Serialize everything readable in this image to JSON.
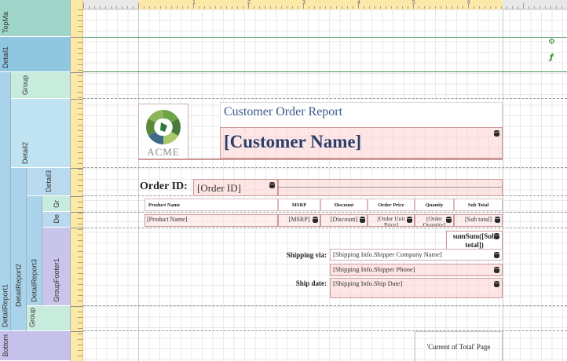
{
  "bands": {
    "top_margin": "TopMa",
    "detail1": "Detail1",
    "group": "Group",
    "detail2": "Detail2",
    "detail3": "Detail3",
    "gr": "Gr",
    "de": "De",
    "detail_report1": "DetailReport1",
    "detail_report2": "DetailReport2",
    "detail_report3": "DetailReport3",
    "group_footer1": "GroupFooter1",
    "group_inner": "Group",
    "bottom": "Bottom"
  },
  "ruler": {
    "numbers": [
      "1",
      "2",
      "3",
      "4",
      "5",
      "6"
    ]
  },
  "report": {
    "title": "Customer Order Report",
    "customer_name": "[Customer Name]",
    "logo_text": "ACME",
    "order_id_label": "Order ID:",
    "order_id_field": "[Order ID]",
    "columns": [
      "Product Name",
      "MSRP",
      "Discount",
      "Order Price",
      "Quanity",
      "Sub Total"
    ],
    "row": [
      "[Product Name]",
      "[MSRP]",
      "[Discount]",
      "[Order Unit Price]",
      "[Order Quantity]",
      "[Sub total]"
    ],
    "sum_field": "sumSum([Sub total])",
    "shipping_via_label": "Shipping via:",
    "shipper_company": "[Shipping Info.Shipper Company Name]",
    "shipper_phone": "[Shipping Info.Shipper Phone]",
    "ship_date_label": "Ship date:",
    "ship_date": "[Shipping Info.Ship Date]",
    "page_info": "'Current of Total' Page"
  },
  "icons": {
    "side_gear": "gear-icon",
    "side_function": "function-icon",
    "db_field": "database-icon"
  },
  "colors": {
    "band_topmargin": "#9fd4c8",
    "band_detail1": "#8fc6e0",
    "band_group": "#c7ecdd",
    "band_detail2": "#bfe3f0",
    "band_detail3": "#b9d9ee",
    "band_detailreport": "#a9d3ea",
    "band_groupfooter": "#c9c4ea",
    "band_bottom": "#c6c1ea",
    "ruler": "#fce9a8",
    "title": "#3a5a8c",
    "field_fill": "#ffd2d2"
  }
}
